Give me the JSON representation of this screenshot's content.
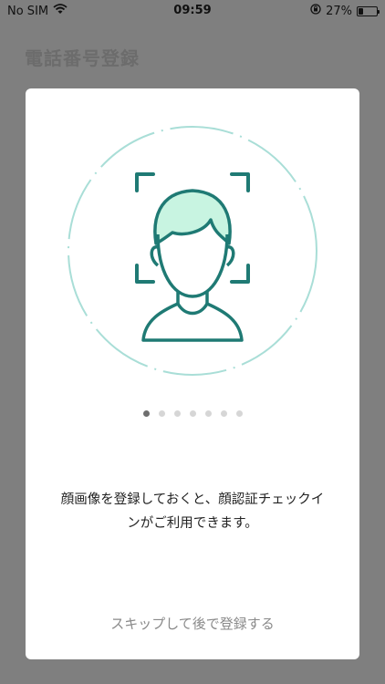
{
  "status_bar": {
    "carrier": "No SIM",
    "time": "09:59",
    "battery_percent_label": "27%",
    "battery_level": 0.27
  },
  "background_page": {
    "title": "電話番号登録"
  },
  "onboarding_card": {
    "illustration_icon": "face-scan-icon",
    "page_count": 7,
    "active_page_index": 0,
    "message_line1": "顔画像を登録しておくと、顔認証チェックイ",
    "message_line2": "ンがご利用できます。",
    "skip_label": "スキップして後で登録する"
  },
  "colors": {
    "overlay": "#7f7f7f",
    "accent_teal": "#1f7a74",
    "hair_mint": "#c8f4e1",
    "circle_dash": "#a9ded7"
  }
}
